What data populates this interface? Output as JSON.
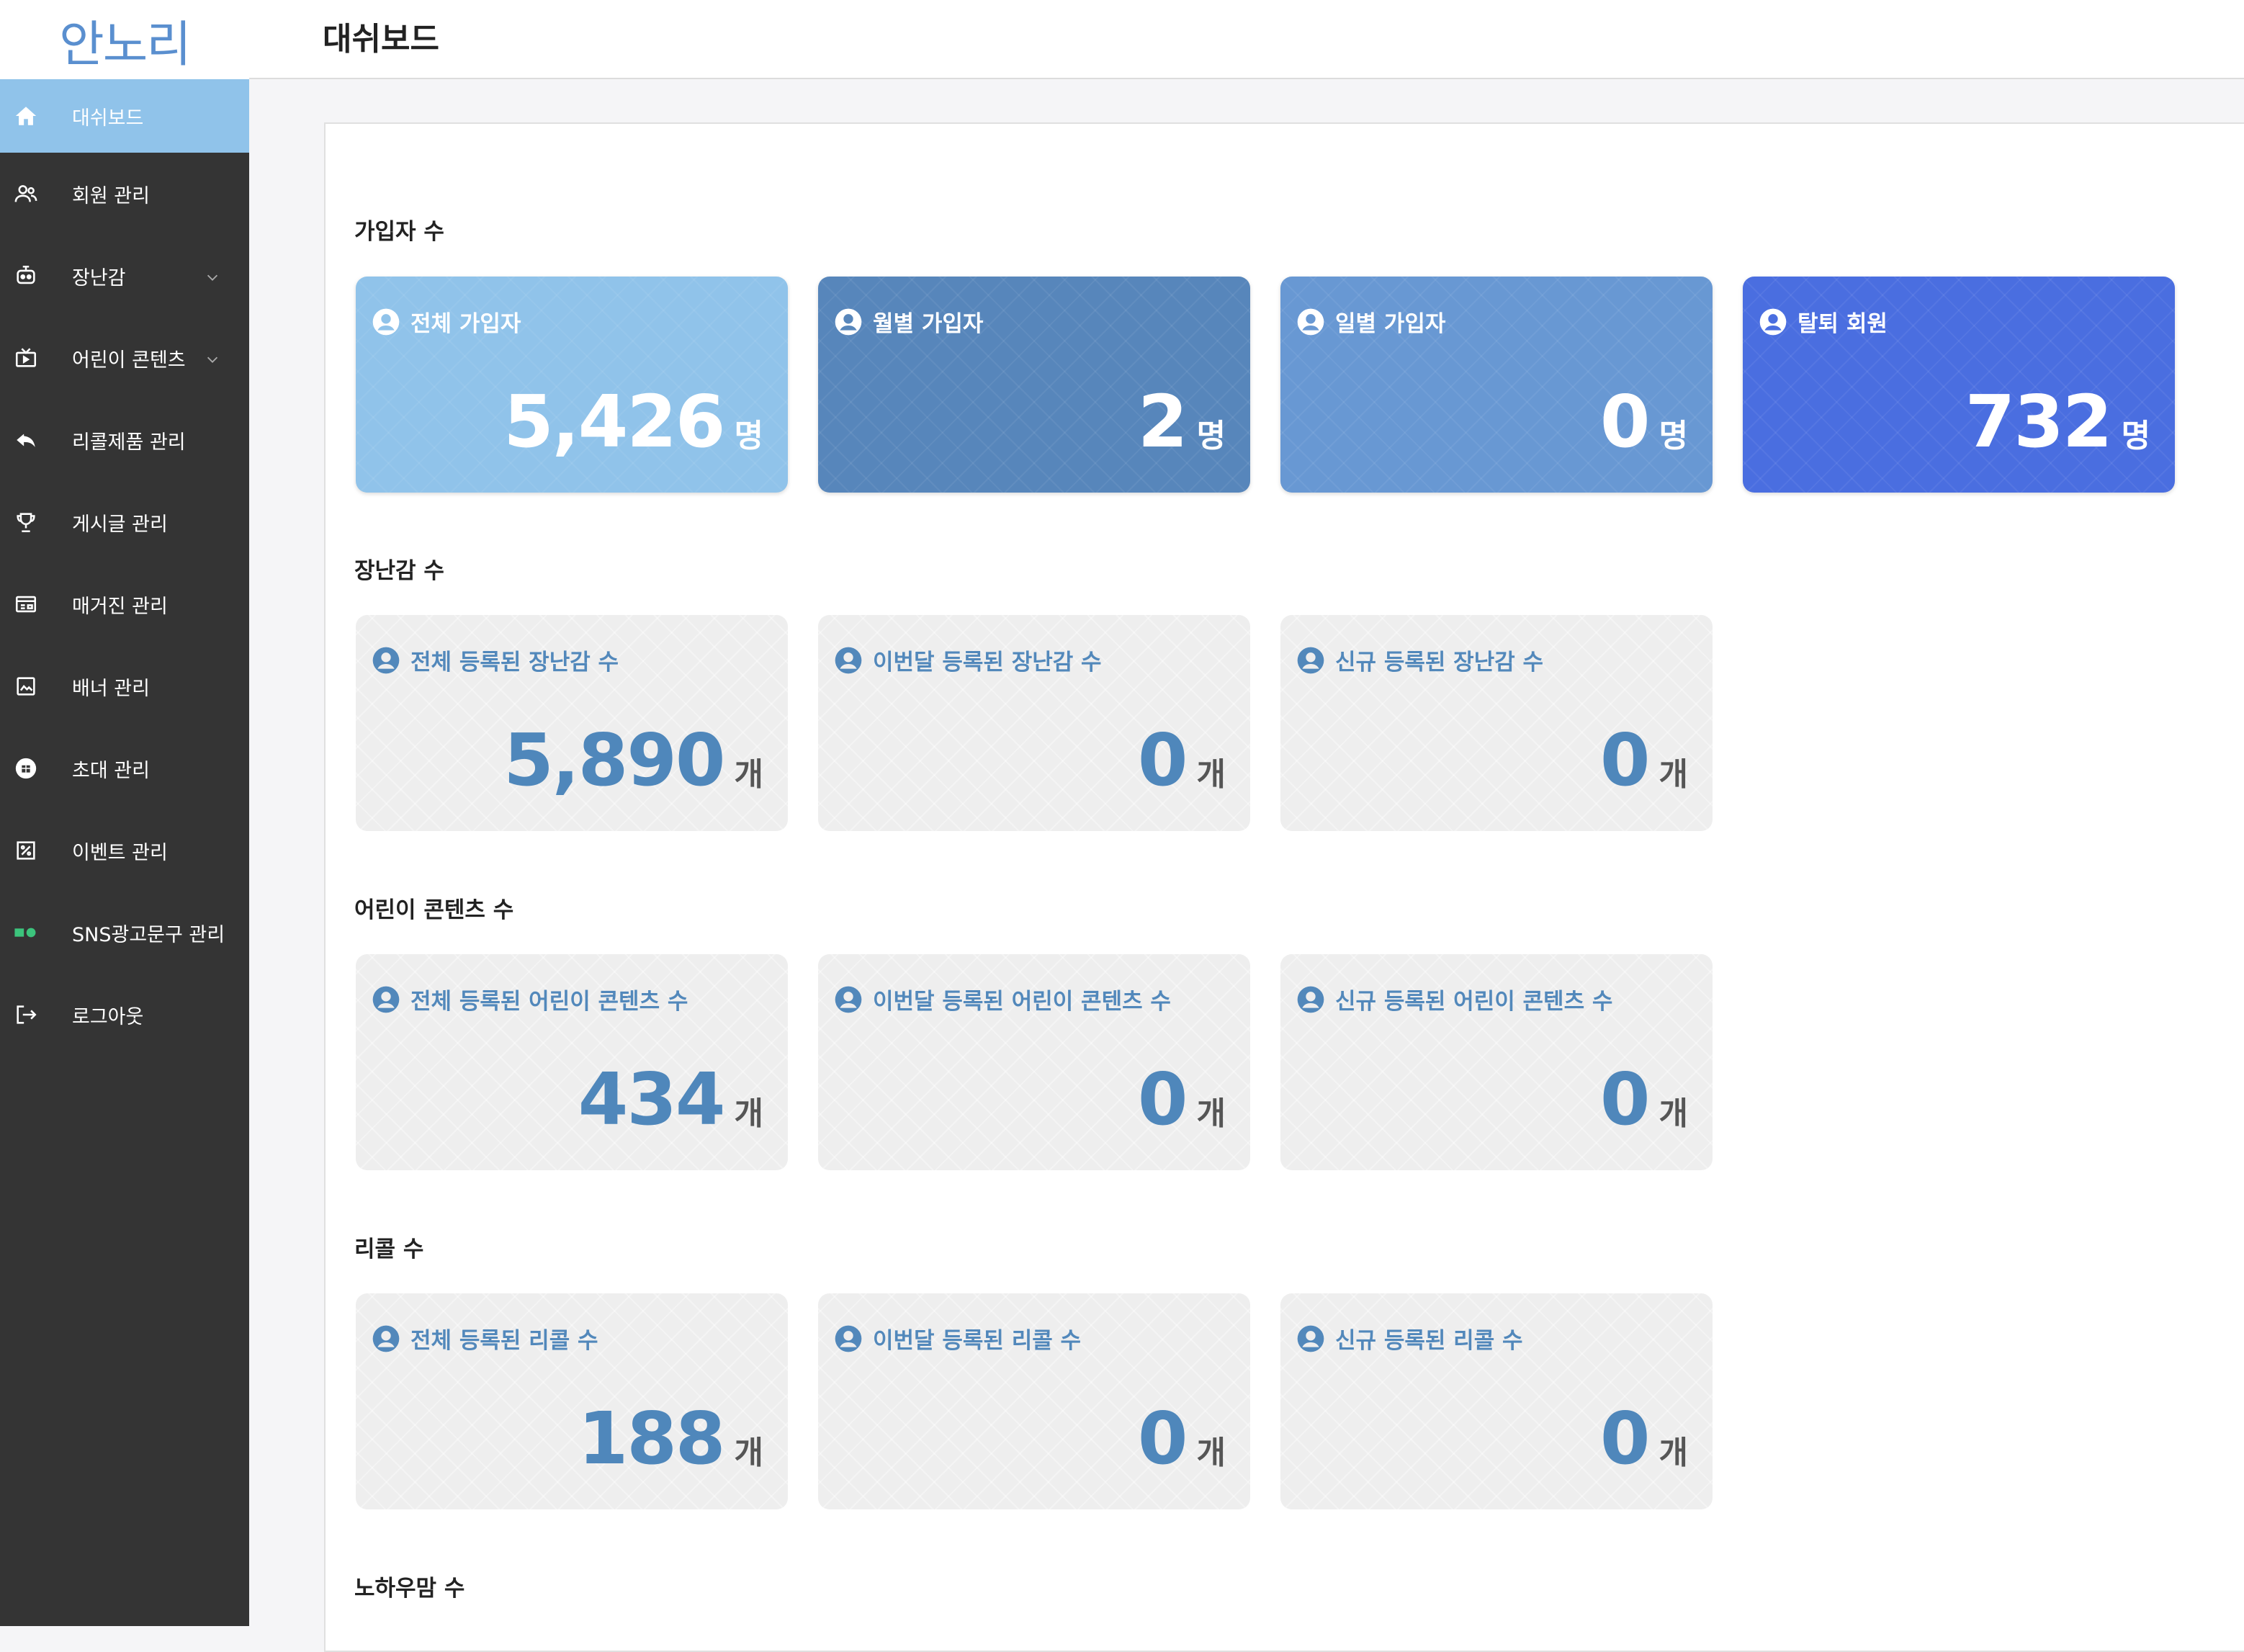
{
  "app": {
    "logo_text": "안노리"
  },
  "header": {
    "title": "대쉬보드"
  },
  "sidebar": {
    "items": [
      {
        "label": "대쉬보드",
        "icon": "home-icon",
        "active": true
      },
      {
        "label": "회원 관리",
        "icon": "users-icon"
      },
      {
        "label": "장난감",
        "icon": "toy-icon",
        "expandable": true
      },
      {
        "label": "어린이 콘텐츠",
        "icon": "tv-icon",
        "expandable": true
      },
      {
        "label": "리콜제품 관리",
        "icon": "reply-icon"
      },
      {
        "label": "게시글 관리",
        "icon": "trophy-icon"
      },
      {
        "label": "매거진 관리",
        "icon": "newspaper-icon"
      },
      {
        "label": "배너 관리",
        "icon": "image-icon"
      },
      {
        "label": "초대 관리",
        "icon": "invite-icon"
      },
      {
        "label": "이벤트 관리",
        "icon": "percent-icon"
      },
      {
        "label": "SNS광고문구 관리",
        "icon": "sns-icon"
      },
      {
        "label": "로그아웃",
        "icon": "logout-icon"
      }
    ]
  },
  "sections": [
    {
      "title": "가입자 수",
      "cards": [
        {
          "label": "전체 가입자",
          "value": "5,426",
          "unit": "명",
          "bg": "#90c3ea"
        },
        {
          "label": "월별 가입자",
          "value": "2",
          "unit": "명",
          "bg": "#5786bb"
        },
        {
          "label": "일별 가입자",
          "value": "0",
          "unit": "명",
          "bg": "#6898d3"
        },
        {
          "label": "탈퇴 회원",
          "value": "732",
          "unit": "명",
          "bg": "#4a6ee0"
        }
      ]
    },
    {
      "title": "장난감 수",
      "cards": [
        {
          "label": "전체 등록된 장난감 수",
          "value": "5,890",
          "unit": "개"
        },
        {
          "label": "이번달 등록된 장난감 수",
          "value": "0",
          "unit": "개"
        },
        {
          "label": "신규 등록된 장난감 수",
          "value": "0",
          "unit": "개"
        }
      ]
    },
    {
      "title": "어린이 콘텐츠 수",
      "cards": [
        {
          "label": "전체 등록된 어린이 콘텐츠 수",
          "value": "434",
          "unit": "개"
        },
        {
          "label": "이번달 등록된 어린이 콘텐츠 수",
          "value": "0",
          "unit": "개"
        },
        {
          "label": "신규 등록된 어린이 콘텐츠 수",
          "value": "0",
          "unit": "개"
        }
      ]
    },
    {
      "title": "리콜 수",
      "cards": [
        {
          "label": "전체 등록된 리콜 수",
          "value": "188",
          "unit": "개"
        },
        {
          "label": "이번달 등록된 리콜 수",
          "value": "0",
          "unit": "개"
        },
        {
          "label": "신규 등록된 리콜 수",
          "value": "0",
          "unit": "개"
        }
      ]
    },
    {
      "title": "노하우맘 수",
      "cards": []
    }
  ]
}
